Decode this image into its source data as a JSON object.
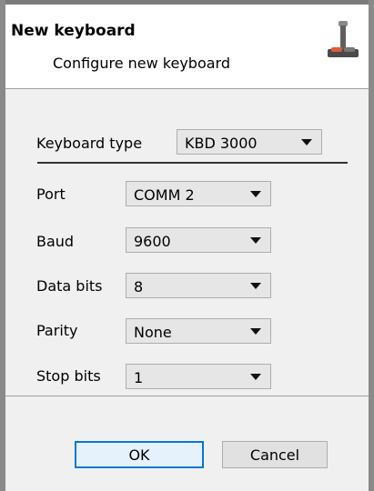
{
  "dialog": {
    "title": "New keyboard",
    "subtitle": "Configure new keyboard",
    "icon": "joystick-icon"
  },
  "form": {
    "keyboard_type": {
      "label": "Keyboard type",
      "value": "KBD 3000"
    },
    "port": {
      "label": "Port",
      "value": "COMM 2"
    },
    "baud": {
      "label": "Baud",
      "value": "9600"
    },
    "data_bits": {
      "label": "Data bits",
      "value": "8"
    },
    "parity": {
      "label": "Parity",
      "value": "None"
    },
    "stop_bits": {
      "label": "Stop bits",
      "value": "1"
    }
  },
  "buttons": {
    "ok": "OK",
    "cancel": "Cancel"
  },
  "colors": {
    "primary_button_border": "#0078d7",
    "joystick_accent": "#e05a3a"
  }
}
